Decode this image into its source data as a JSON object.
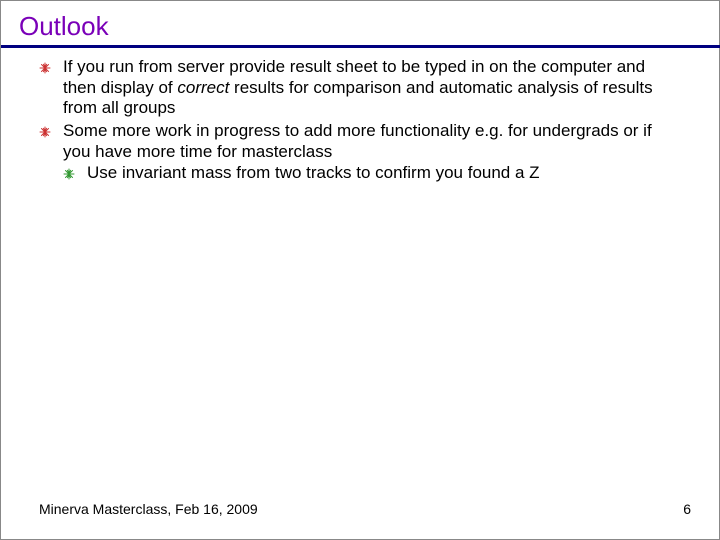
{
  "title": "Outlook",
  "bullets": {
    "b1": "If you run from server provide result sheet to be typed in on the computer and then display of ",
    "b1_em": "correct",
    "b1_tail": " results for comparison and automatic analysis of results from all groups",
    "b2": "Some more work in progress to add more functionality e.g. for undergrads or if you have more time for masterclass",
    "b2_1": "Use invariant mass from two tracks to confirm you found a Z"
  },
  "footer": {
    "left": "Minerva Masterclass, Feb 16, 2009",
    "right": "6"
  },
  "icons": {
    "bullet": "burst-icon"
  }
}
